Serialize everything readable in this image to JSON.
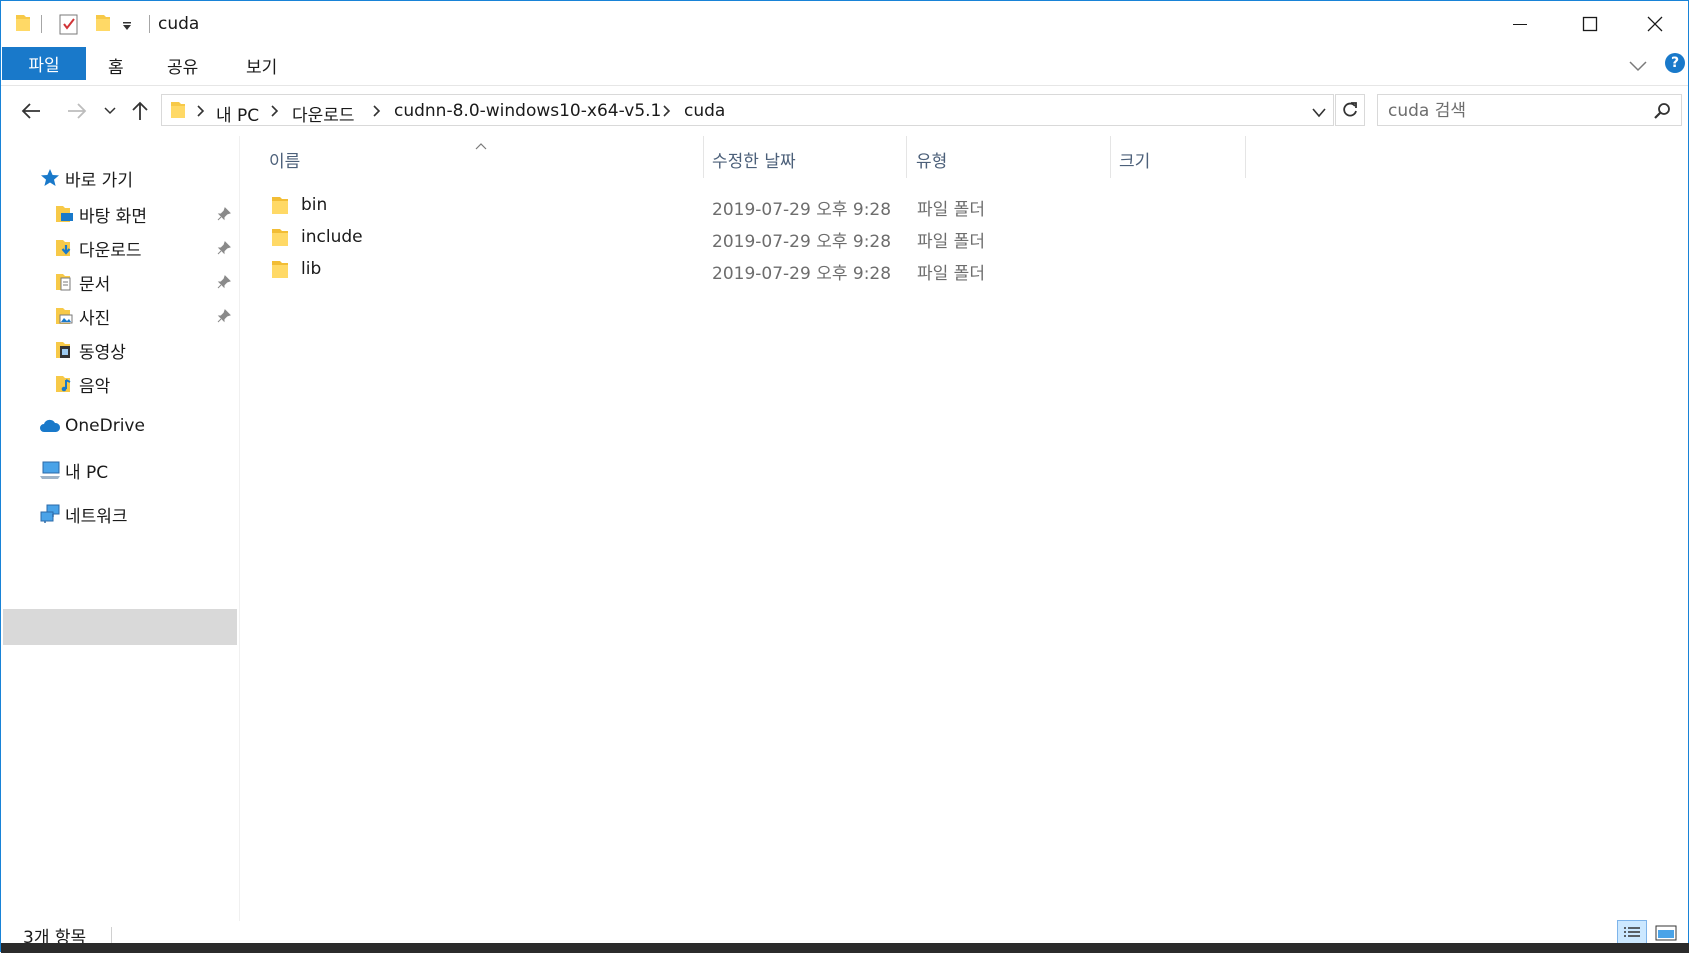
{
  "window": {
    "title": "cuda",
    "accent_color": "#1979ca"
  },
  "ribbon": {
    "tabs": [
      "파일",
      "홈",
      "공유",
      "보기"
    ],
    "help_label": "?"
  },
  "address": {
    "crumbs": [
      "내 PC",
      "다운로드",
      "cudnn-8.0-windows10-x64-v5.1",
      "cuda"
    ],
    "search_placeholder": "cuda 검색"
  },
  "nav": {
    "quick_access": "바로 가기",
    "pinned": [
      {
        "label": "바탕 화면",
        "icon": "desktop-folder-icon",
        "pinned": true
      },
      {
        "label": "다운로드",
        "icon": "downloads-folder-icon",
        "pinned": true
      },
      {
        "label": "문서",
        "icon": "documents-folder-icon",
        "pinned": true
      },
      {
        "label": "사진",
        "icon": "pictures-folder-icon",
        "pinned": true
      },
      {
        "label": "동영상",
        "icon": "videos-folder-icon",
        "pinned": false
      },
      {
        "label": "음악",
        "icon": "music-folder-icon",
        "pinned": false
      }
    ],
    "onedrive": "OneDrive",
    "this_pc": "내 PC",
    "network": "네트워크"
  },
  "files": {
    "columns": {
      "name": "이름",
      "date": "수정한 날짜",
      "type": "유형",
      "size": "크기"
    },
    "rows": [
      {
        "name": "bin",
        "date": "2019-07-29 오후 9:28",
        "type": "파일 폴더"
      },
      {
        "name": "include",
        "date": "2019-07-29 오후 9:28",
        "type": "파일 폴더"
      },
      {
        "name": "lib",
        "date": "2019-07-29 오후 9:28",
        "type": "파일 폴더"
      }
    ]
  },
  "status": {
    "item_count": "3개 항목"
  }
}
